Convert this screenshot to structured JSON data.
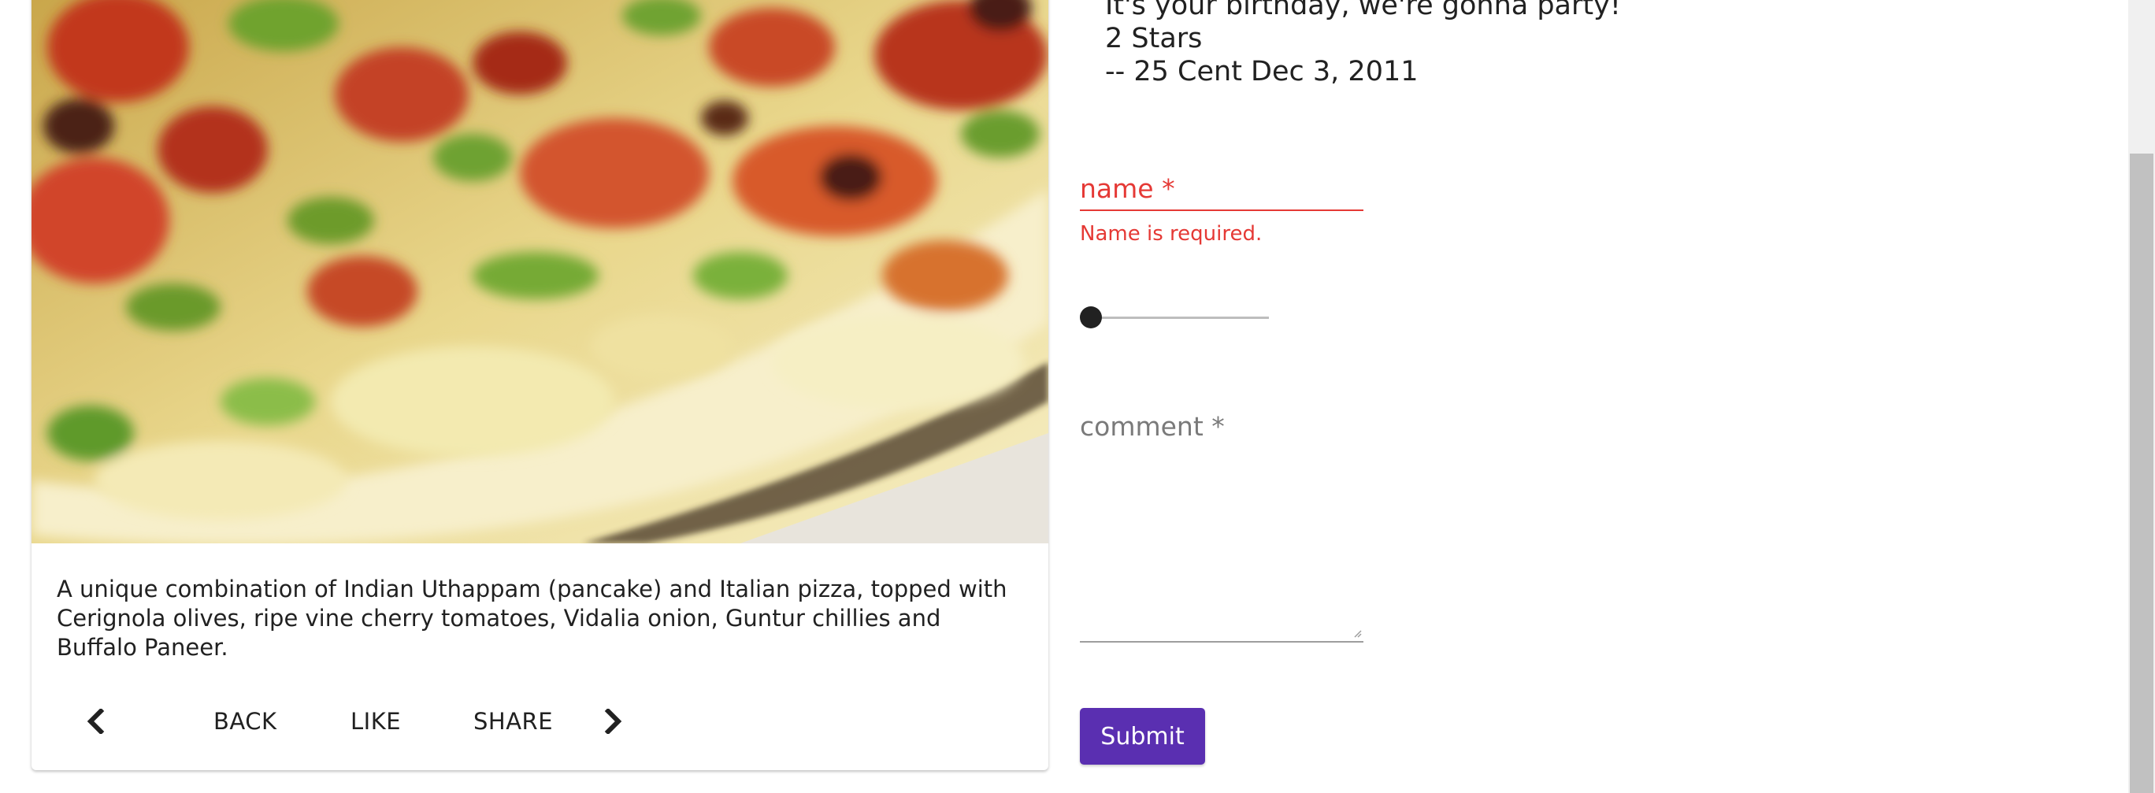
{
  "dish": {
    "image_alt": "Uthappizza",
    "description": "A unique combination of Indian Uthappam (pancake) and Italian pizza, topped with Cerignola olives, ripe vine cherry tomatoes, Vidalia onion, Guntur chillies and Buffalo Paneer."
  },
  "card_actions": {
    "prev_icon": "chevron-left-icon",
    "back_label": "BACK",
    "like_label": "LIKE",
    "share_label": "SHARE",
    "next_icon": "chevron-right-icon"
  },
  "comment": {
    "text": "It's your birthday, we're gonna party!",
    "rating": "2 Stars",
    "byline": "-- 25 Cent Dec 3, 2011"
  },
  "form": {
    "name_label": "name *",
    "name_value": "",
    "name_error": "Name is required.",
    "rating_slider_value_fraction": 0,
    "comment_label": "comment *",
    "comment_value": "",
    "submit_label": "Submit"
  },
  "colors": {
    "error": "#e53935",
    "submit_background": "#5a2fb1",
    "text": "#212121"
  }
}
